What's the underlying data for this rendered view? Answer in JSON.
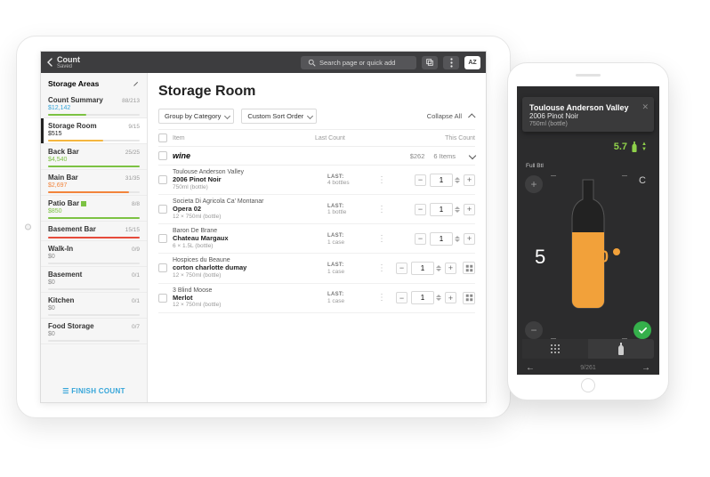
{
  "colors": {
    "accent_blue": "#35a5d9",
    "accent_green": "#35b04b",
    "accent_orange": "#f2a13a",
    "bar_green": "#7cc243",
    "bar_yellow": "#f4b63f",
    "bar_orange": "#f2843b",
    "bar_red": "#e64b3b"
  },
  "topbar": {
    "back_title": "Count",
    "back_sub": "Saved",
    "search_placeholder": "Search page or quick add",
    "user_badge": "AZ"
  },
  "sidebar": {
    "heading": "Storage Areas",
    "items": [
      {
        "name": "Count Summary",
        "amount": "$12,142",
        "count": "88/213",
        "amt_color": "#35a5d9",
        "bar_color": "#7cc243",
        "bar_pct": 42
      },
      {
        "name": "Storage Room",
        "amount": "$515",
        "count": "9/15",
        "amt_color": "#222222",
        "bar_color": "#f4b63f",
        "bar_pct": 60,
        "active": true
      },
      {
        "name": "Back Bar",
        "amount": "$4,540",
        "count": "25/25",
        "amt_color": "#7cc243",
        "bar_color": "#7cc243",
        "bar_pct": 100
      },
      {
        "name": "Main Bar",
        "amount": "$2,697",
        "count": "31/35",
        "amt_color": "#f2843b",
        "bar_color": "#f2843b",
        "bar_pct": 88
      },
      {
        "name": "Patio Bar",
        "amount": "$850",
        "count": "8/8",
        "amt_color": "#7cc243",
        "bar_color": "#7cc243",
        "bar_pct": 100,
        "inline_badge": true
      },
      {
        "name": "Basement Bar",
        "amount": "",
        "count": "15/15",
        "amt_color": "#777777",
        "bar_color": "#e64b3b",
        "bar_pct": 100
      },
      {
        "name": "Walk-In",
        "amount": "$0",
        "count": "0/9",
        "amt_color": "#888888",
        "bar_color": "#e6e6e6",
        "bar_pct": 0
      },
      {
        "name": "Basement",
        "amount": "$0",
        "count": "0/1",
        "amt_color": "#888888",
        "bar_color": "#e6e6e6",
        "bar_pct": 0
      },
      {
        "name": "Kitchen",
        "amount": "$0",
        "count": "0/1",
        "amt_color": "#888888",
        "bar_color": "#e6e6e6",
        "bar_pct": 0
      },
      {
        "name": "Food Storage",
        "amount": "$0",
        "count": "0/7",
        "amt_color": "#888888",
        "bar_color": "#e6e6e6",
        "bar_pct": 0
      }
    ],
    "finish_label": "FINISH COUNT"
  },
  "main": {
    "page_title": "Storage Room",
    "group_by_label": "Group by Category",
    "sort_label": "Custom Sort Order",
    "collapse_label": "Collapse All",
    "columns": {
      "item": "Item",
      "last": "Last Count",
      "this": "This Count"
    },
    "group": {
      "name": "wine",
      "subtotal": "$262",
      "count": "6 Items"
    },
    "items": [
      {
        "brand": "Toulouse Anderson Valley",
        "name": "2006 Pinot Noir",
        "pkg": "750ml (bottle)",
        "last_label": "LAST:",
        "last_val": "4 bottles",
        "qty": "1"
      },
      {
        "brand": "Societa Di Agricola Ca' Montanar",
        "name": "Opera 02",
        "pkg": "12 × 750ml (bottle)",
        "last_label": "LAST:",
        "last_val": "1 bottle",
        "qty": "1"
      },
      {
        "brand": "Baron De Brane",
        "name": "Chateau Margaux",
        "pkg": "6 × 1.5L (bottle)",
        "last_label": "LAST:",
        "last_val": "1 case",
        "qty": "1"
      },
      {
        "brand": "Hospices du Beaune",
        "name": "corton charlotte dumay",
        "pkg": "12 × 750ml (bottle)",
        "last_label": "LAST:",
        "last_val": "1 case",
        "qty": "1",
        "extra_icon": true
      },
      {
        "brand": "3 Blind Moose",
        "name": "Merlot",
        "pkg": "12 × 750ml (bottle)",
        "last_label": "LAST:",
        "last_val": "1 case",
        "qty": "1",
        "extra_icon": true
      }
    ]
  },
  "phone": {
    "brand": "Toulouse Anderson Valley",
    "name": "2006 Pinot Noir",
    "pkg": "750ml (bottle)",
    "reading": "5.7",
    "full_btl_label": "Full Btl",
    "whole": "5",
    "fraction": ".70",
    "clear": "C",
    "progress": "9/261"
  }
}
